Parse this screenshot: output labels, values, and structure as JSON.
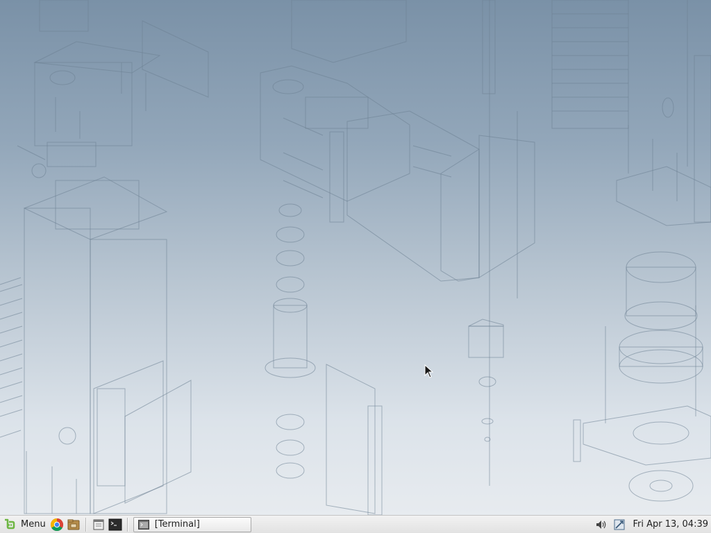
{
  "taskbar": {
    "menu_label": "Menu",
    "launchers": [
      {
        "name": "chrome-icon"
      },
      {
        "name": "file-manager-icon"
      },
      {
        "name": "show-desktop-icon"
      },
      {
        "name": "terminal-icon"
      }
    ],
    "windows": [
      {
        "title": "[Terminal]",
        "icon": "terminal-window-icon"
      }
    ],
    "tray": {
      "icons": [
        "volume-icon",
        "network-icon"
      ],
      "clock": "Fri Apr 13, 04:39"
    }
  },
  "colors": {
    "mint_green": "#6fb744",
    "panel_bg": "#e6e6e6",
    "wallpaper_top": "#7a91a7",
    "wallpaper_bottom": "#e7ebef"
  }
}
